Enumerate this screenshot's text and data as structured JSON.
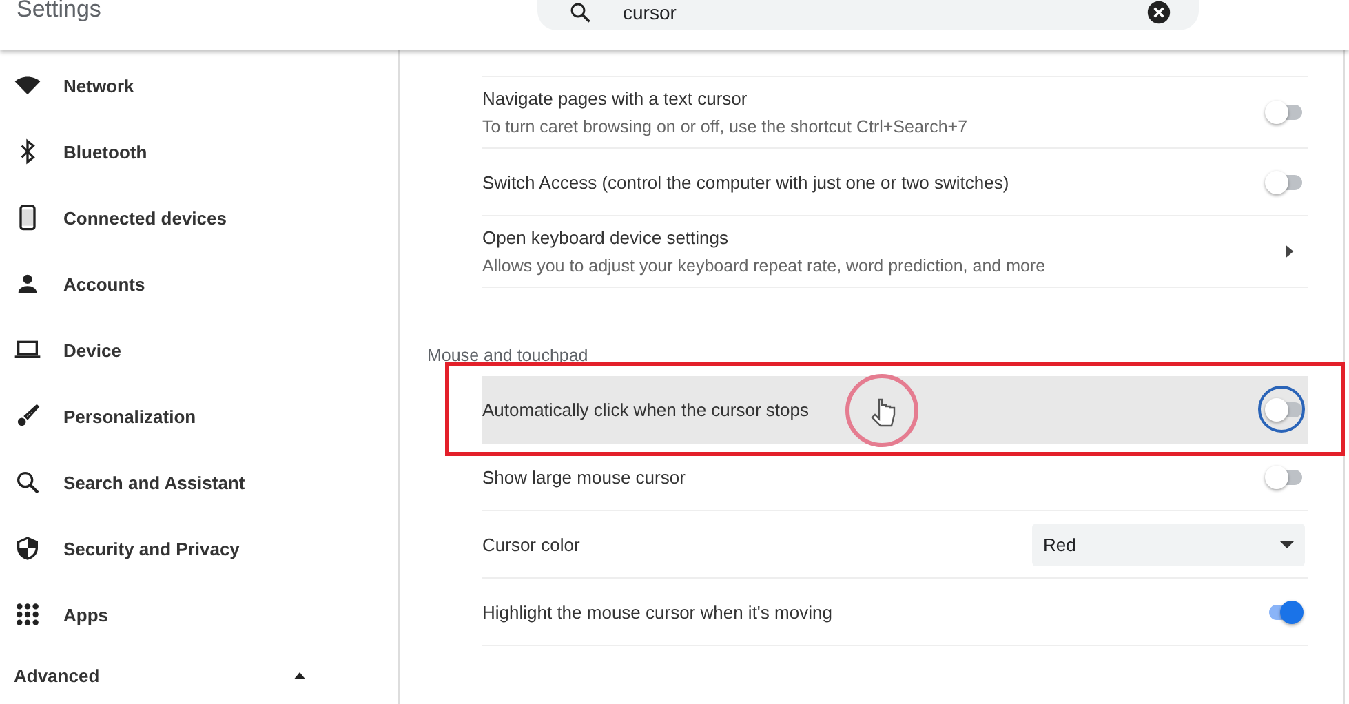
{
  "header": {
    "title": "Settings",
    "search": {
      "value": "cursor"
    }
  },
  "sidebar": {
    "items": [
      {
        "label": "Network"
      },
      {
        "label": "Bluetooth"
      },
      {
        "label": "Connected devices"
      },
      {
        "label": "Accounts"
      },
      {
        "label": "Device"
      },
      {
        "label": "Personalization"
      },
      {
        "label": "Search and Assistant"
      },
      {
        "label": "Security and Privacy"
      },
      {
        "label": "Apps"
      }
    ],
    "advanced": {
      "label": "Advanced",
      "expanded": true
    }
  },
  "sections": [
    {
      "rows": [
        {
          "kind": "toggle",
          "title": "Navigate pages with a text cursor",
          "subtitle": "To turn caret browsing on or off, use the shortcut Ctrl+Search+7",
          "on": false
        },
        {
          "kind": "toggle",
          "title": "Switch Access (control the computer with just one or two switches)",
          "on": false
        },
        {
          "kind": "link",
          "title": "Open keyboard device settings",
          "subtitle": "Allows you to adjust your keyboard repeat rate, word prediction, and more"
        }
      ]
    },
    {
      "heading": "Mouse and touchpad",
      "rows": [
        {
          "kind": "toggle",
          "title": "Automatically click when the cursor stops",
          "on": false,
          "highlighted": true,
          "focused": true,
          "annotated": true,
          "click_marker": true
        },
        {
          "kind": "toggle",
          "title": "Show large mouse cursor",
          "on": false
        },
        {
          "kind": "dropdown",
          "title": "Cursor color",
          "value": "Red"
        },
        {
          "kind": "toggle",
          "title": "Highlight the mouse cursor when it's moving",
          "on": true
        }
      ]
    }
  ]
}
